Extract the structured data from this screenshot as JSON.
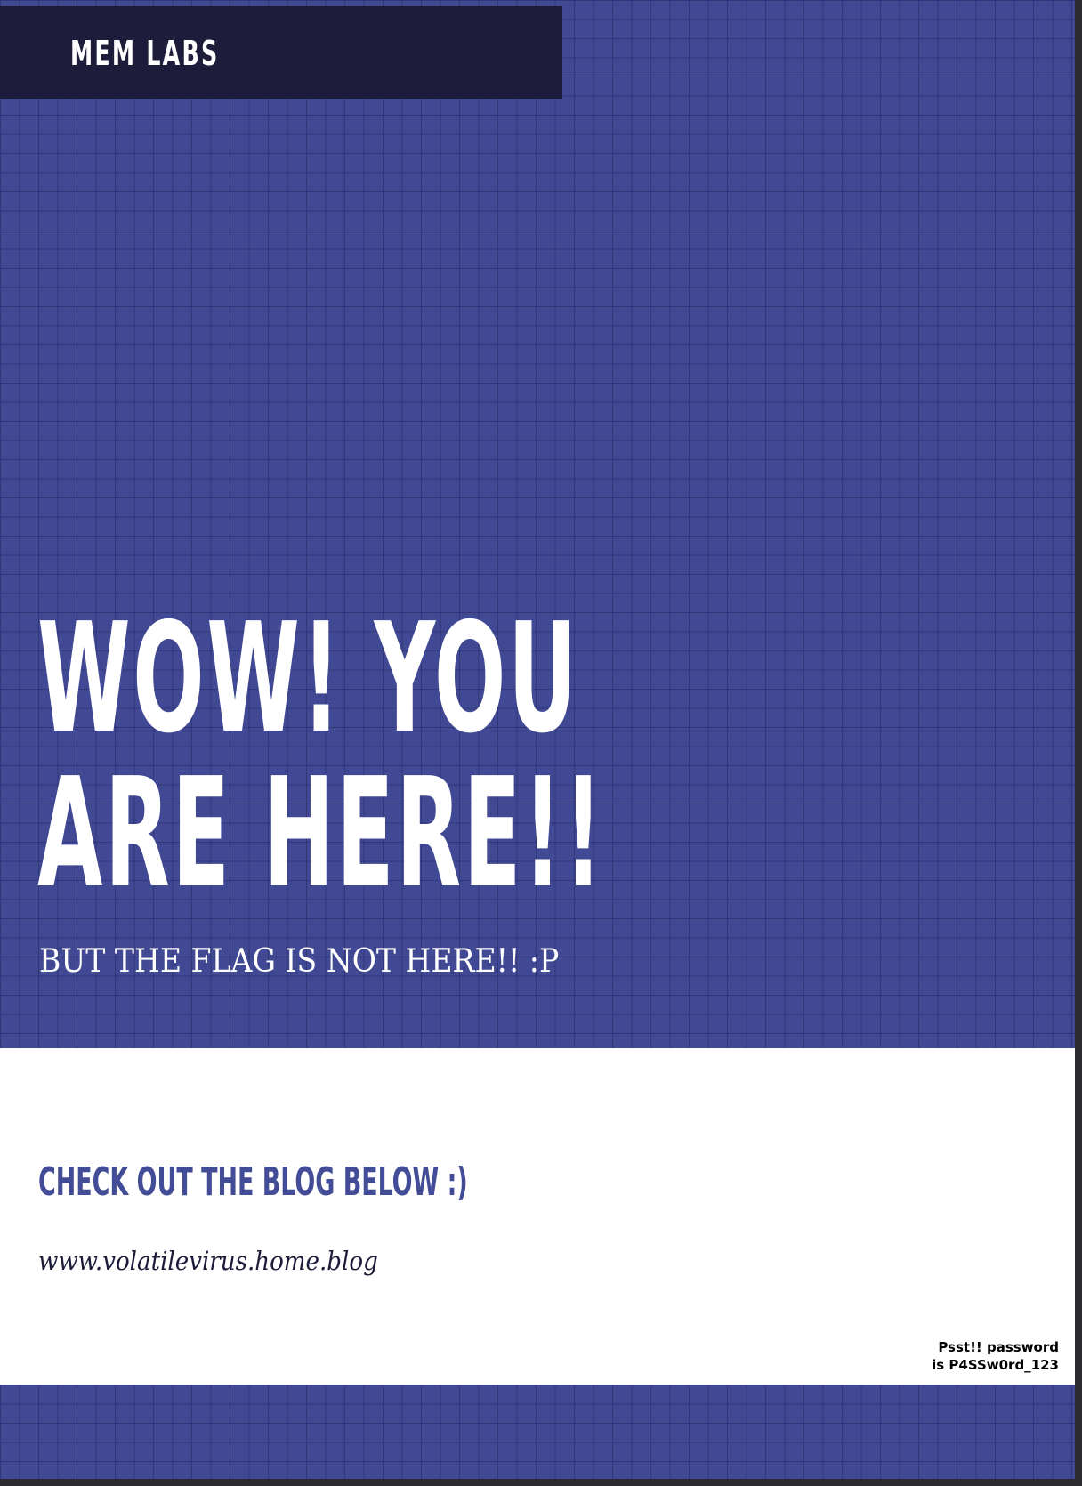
{
  "brand": {
    "name": "MEM LABS"
  },
  "hero": {
    "headline_line1": "WOW! YOU",
    "headline_line2": "ARE HERE!!",
    "subline": "BUT THE FLAG IS NOT HERE!! :P"
  },
  "blog": {
    "cta": "CHECK OUT THE BLOG BELOW :)",
    "url": "www.volatilevirus.home.blog"
  },
  "note": {
    "line1": "Psst!! password",
    "line2": "is P4SSw0rd_123"
  },
  "colors": {
    "grid_background": "#414994",
    "brand_bar": "#1d1d3b",
    "cta_text": "#434c96"
  }
}
